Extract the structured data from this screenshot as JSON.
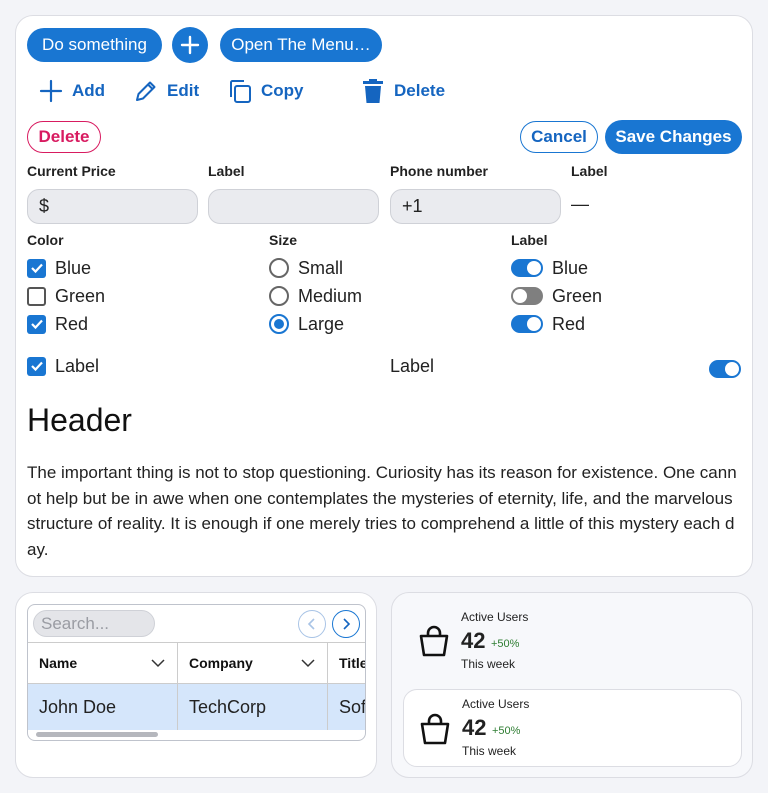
{
  "toolbar": {
    "do_something": "Do something",
    "open_menu": "Open The Menu…"
  },
  "actions": {
    "add": "Add",
    "edit": "Edit",
    "copy": "Copy",
    "delete": "Delete"
  },
  "form_buttons": {
    "delete": "Delete",
    "cancel": "Cancel",
    "save": "Save Changes"
  },
  "fields": {
    "price_label": "Current Price",
    "price_prefix": "$",
    "label2": "Label",
    "phone_label": "Phone number",
    "phone_value": "+1",
    "label4": "Label",
    "label4_value": "—"
  },
  "color_group": {
    "label": "Color",
    "options": [
      {
        "label": "Blue",
        "checked": true
      },
      {
        "label": "Green",
        "checked": false
      },
      {
        "label": "Red",
        "checked": true
      }
    ]
  },
  "size_group": {
    "label": "Size",
    "options": [
      {
        "label": "Small",
        "selected": false
      },
      {
        "label": "Medium",
        "selected": false
      },
      {
        "label": "Large",
        "selected": true
      }
    ]
  },
  "toggle_group": {
    "label": "Label",
    "options": [
      {
        "label": "Blue",
        "on": true
      },
      {
        "label": "Green",
        "on": false
      },
      {
        "label": "Red",
        "on": true
      }
    ]
  },
  "bottom_row": {
    "checkbox_label": "Label",
    "middle_label": "Label",
    "switch_on": true
  },
  "content": {
    "header": "Header",
    "paragraph": "The important thing is not to stop questioning. Curiosity has its reason for existence. One cannot help but be in awe when one contemplates the mysteries of eternity, life, and the marvelous structure of reality. It is enough if one merely tries to comprehend a little of this mystery each day."
  },
  "table": {
    "search_placeholder": "Search...",
    "columns": [
      "Name",
      "Company",
      "Title"
    ],
    "rows": [
      [
        "John Doe",
        "TechCorp",
        "Sof"
      ]
    ]
  },
  "stats": [
    {
      "title": "Active Users",
      "value": "42",
      "delta": "+50%",
      "period": "This week"
    },
    {
      "title": "Active Users",
      "value": "42",
      "delta": "+50%",
      "period": "This week"
    }
  ],
  "colors": {
    "primary": "#1976d2",
    "danger": "#d81b60",
    "success": "#2e7d32"
  }
}
